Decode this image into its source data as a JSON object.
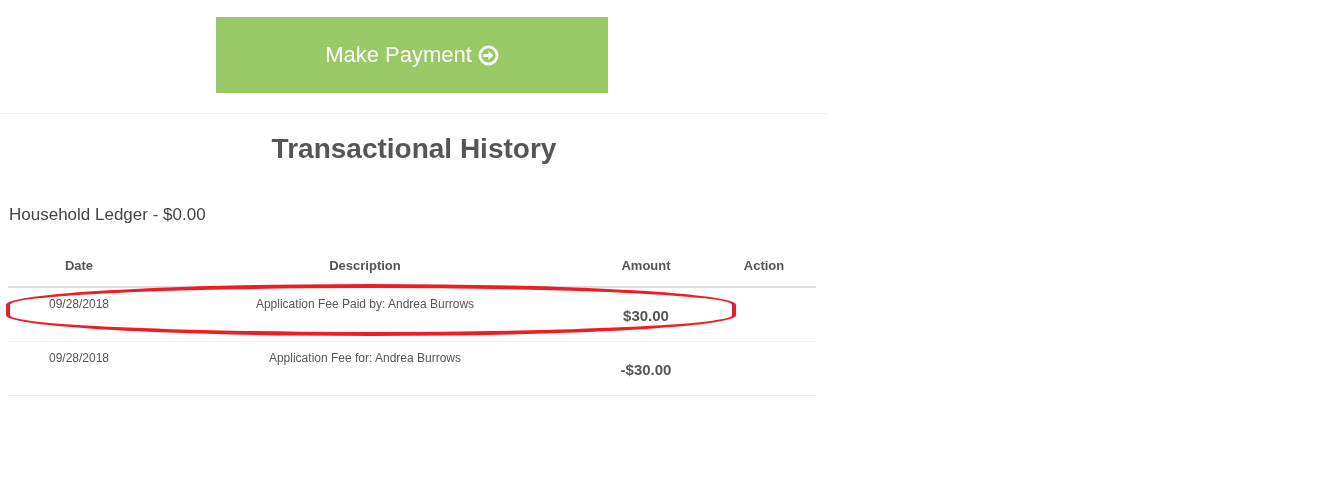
{
  "payment_button": {
    "label": "Make Payment"
  },
  "title": "Transactional History",
  "ledger": "Household Ledger - $0.00",
  "table": {
    "columns": [
      "Date",
      "Description",
      "Amount",
      "Action"
    ],
    "rows": [
      {
        "date": "09/28/2018",
        "description": "Application Fee Paid by: Andrea Burrows",
        "amount": "$30.00",
        "circled": true
      },
      {
        "date": "09/28/2018",
        "description": "Application Fee for: Andrea Burrows",
        "amount": "-$30.00",
        "circled": false
      }
    ]
  }
}
